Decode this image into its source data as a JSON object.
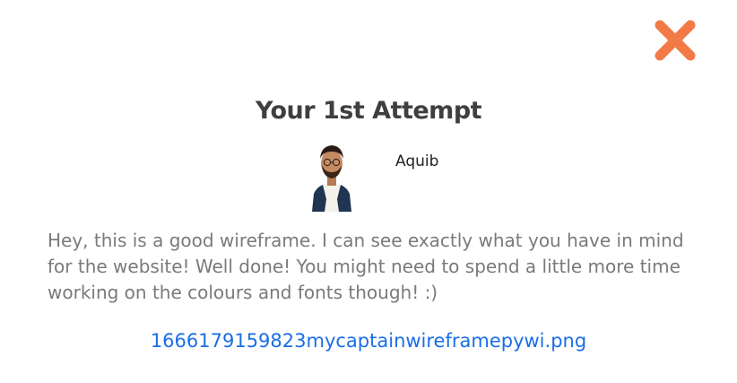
{
  "modal": {
    "title": "Your 1st Attempt",
    "author_name": "Aquib",
    "comment": "Hey, this is a good wireframe. I can see exactly what you have in mind for the website! Well done! You might need to spend a little more time working on the colours and fonts though! :)",
    "attachment_link": "1666179159823mycaptainwireframepywi.png",
    "close_icon": "close-icon",
    "accent_color": "#f27a47",
    "link_color": "#1a6ee6"
  }
}
